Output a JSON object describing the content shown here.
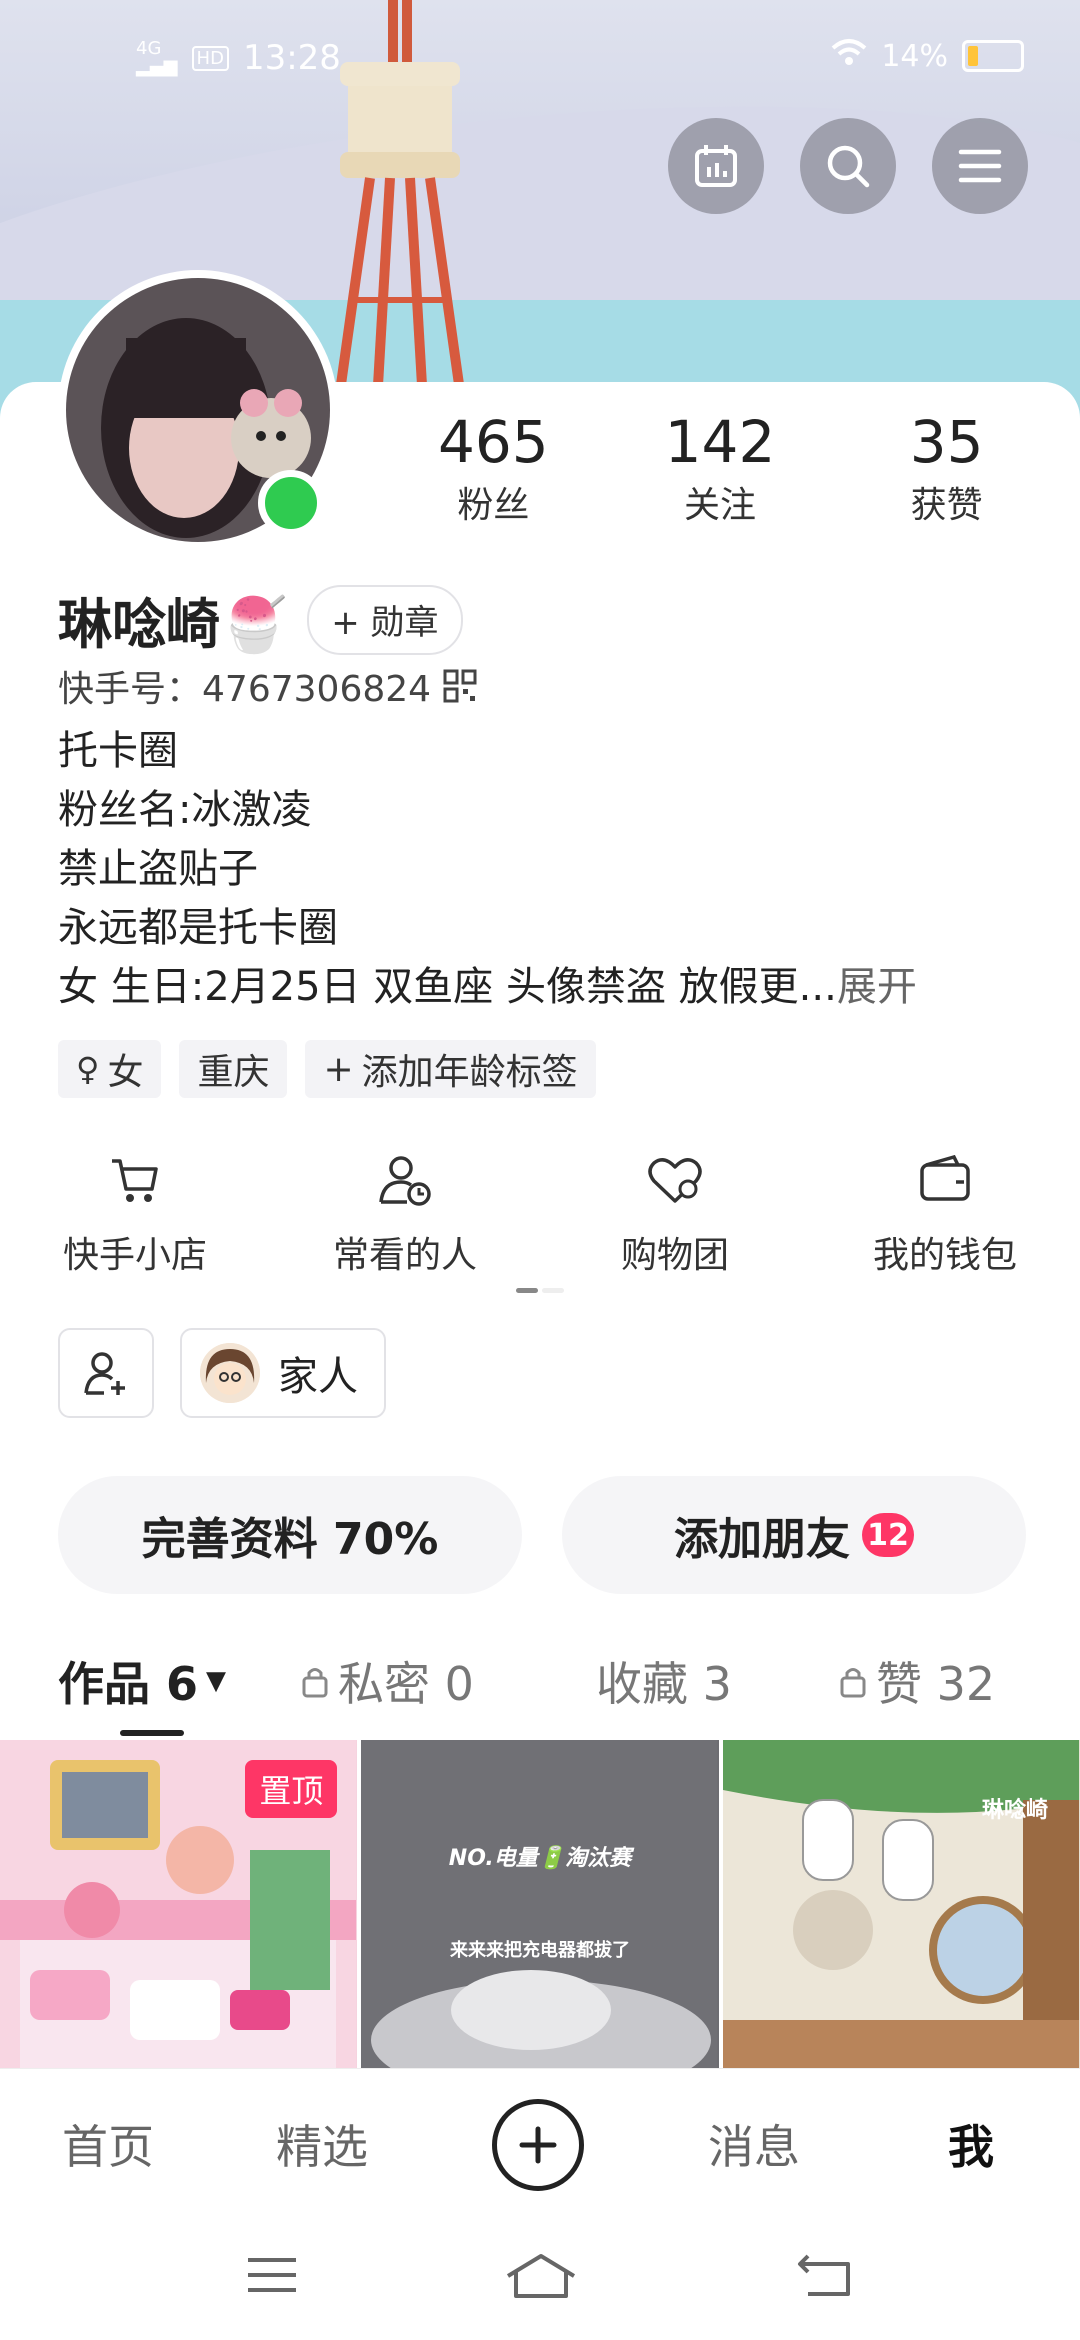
{
  "status_bar": {
    "network": "4G",
    "hd": "HD",
    "time": "13:28",
    "battery_pct": "14%",
    "battery_level": 0.14
  },
  "header_icons": [
    "calendar-icon",
    "search-icon",
    "menu-icon"
  ],
  "profile": {
    "name": "琳唸崎",
    "emoji": "🍧",
    "badge_label": "+ 勋章",
    "kuaishou_id_label": "快手号：",
    "kuaishou_id": "4767306824",
    "online": true
  },
  "stats": [
    {
      "value": "465",
      "label": "粉丝"
    },
    {
      "value": "142",
      "label": "关注"
    },
    {
      "value": "35",
      "label": "获赞"
    }
  ],
  "bio": {
    "lines": [
      "托卡圈",
      "粉丝名:冰激凌",
      "禁止盗贴子",
      "永远都是托卡圈"
    ],
    "last_line": "女 生日:2月25日 双鱼座 头像禁盗 放假更...",
    "expand": "展开"
  },
  "tags": [
    {
      "icon": "female-icon",
      "label": "女"
    },
    {
      "icon": "",
      "label": "重庆"
    },
    {
      "icon": "plus-icon",
      "label": "添加年龄标签"
    }
  ],
  "shortcuts": [
    {
      "icon": "cart-icon",
      "label": "快手小店"
    },
    {
      "icon": "user-clock-icon",
      "label": "常看的人"
    },
    {
      "icon": "heart-icon",
      "label": "购物团"
    },
    {
      "icon": "wallet-icon",
      "label": "我的钱包"
    }
  ],
  "family": {
    "label": "家人"
  },
  "actions": {
    "complete_profile": "完善资料 70%",
    "add_friends": "添加朋友",
    "add_friends_count": "12"
  },
  "tabs": [
    {
      "label": "作品 6",
      "active": true,
      "locked": false,
      "has_dropdown": true
    },
    {
      "label": "私密 0",
      "active": false,
      "locked": true
    },
    {
      "label": "收藏 3",
      "active": false,
      "locked": false
    },
    {
      "label": "赞 32",
      "active": false,
      "locked": true
    }
  ],
  "posts": [
    {
      "pinned_label": "置顶"
    },
    {
      "title": "NO.电量🔋淘汰赛",
      "caption": "来来来把充电器都拔了"
    },
    {
      "watermark": "琳唸崎"
    }
  ],
  "bottom_nav": [
    {
      "label": "首页",
      "active": false
    },
    {
      "label": "精选",
      "active": false
    },
    {
      "label": "消息",
      "active": false
    },
    {
      "label": "我",
      "active": true
    }
  ],
  "colors": {
    "accent": "#fe3666",
    "online": "#2fcb50",
    "battery": "#ffc43a"
  }
}
